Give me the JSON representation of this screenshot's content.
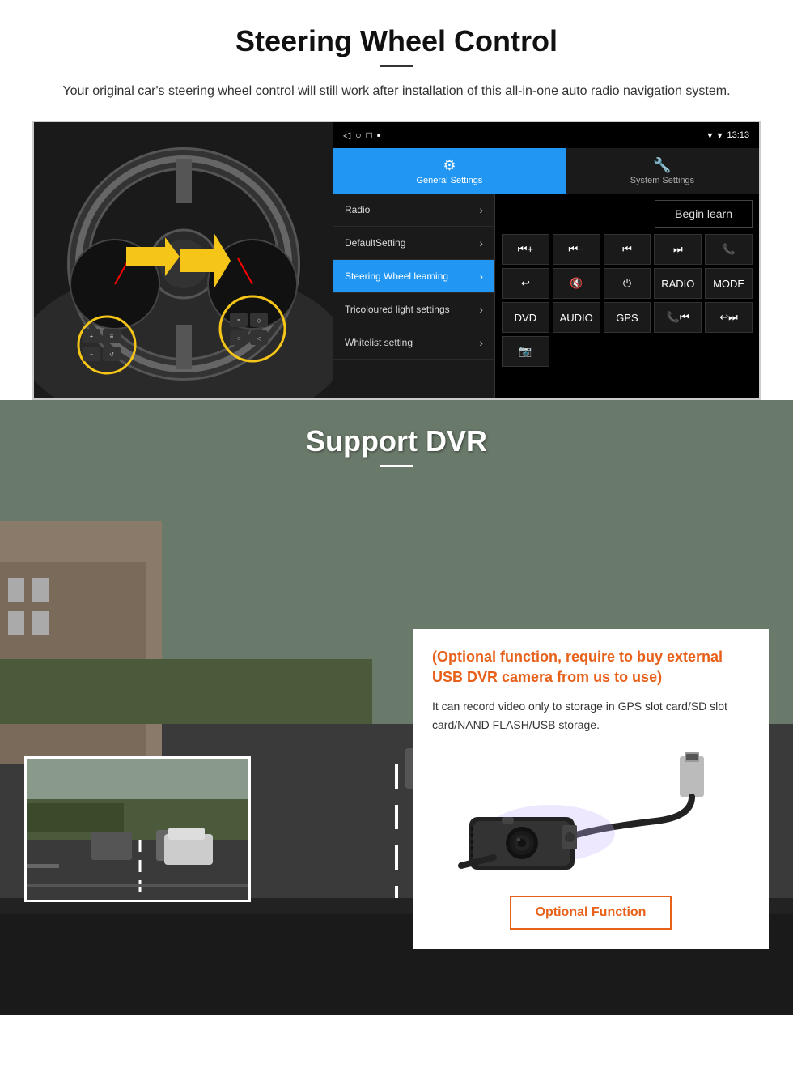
{
  "section1": {
    "title": "Steering Wheel Control",
    "subtitle": "Your original car's steering wheel control will still work after installation of this all-in-one auto radio navigation system.",
    "statusbar": {
      "time": "13:13",
      "icons": "▾ ▾"
    },
    "tabs": {
      "general": "General Settings",
      "system": "System Settings"
    },
    "menu_items": [
      {
        "label": "Radio",
        "active": false
      },
      {
        "label": "DefaultSetting",
        "active": false
      },
      {
        "label": "Steering Wheel learning",
        "active": true
      },
      {
        "label": "Tricoloured light settings",
        "active": false
      },
      {
        "label": "Whitelist setting",
        "active": false
      }
    ],
    "begin_learn": "Begin learn",
    "control_buttons": [
      "⏮+",
      "⏮-",
      "⏮",
      "⏭",
      "📞",
      "↩",
      "🔇",
      "⏻",
      "RADIO",
      "MODE",
      "DVD",
      "AUDIO",
      "GPS",
      "📞⏮",
      "↩⏭",
      "📷"
    ]
  },
  "section2": {
    "title": "Support DVR",
    "optional_title": "(Optional function, require to buy external USB DVR camera from us to use)",
    "description": "It can record video only to storage in GPS slot card/SD slot card/NAND FLASH/USB storage.",
    "optional_button": "Optional Function"
  }
}
